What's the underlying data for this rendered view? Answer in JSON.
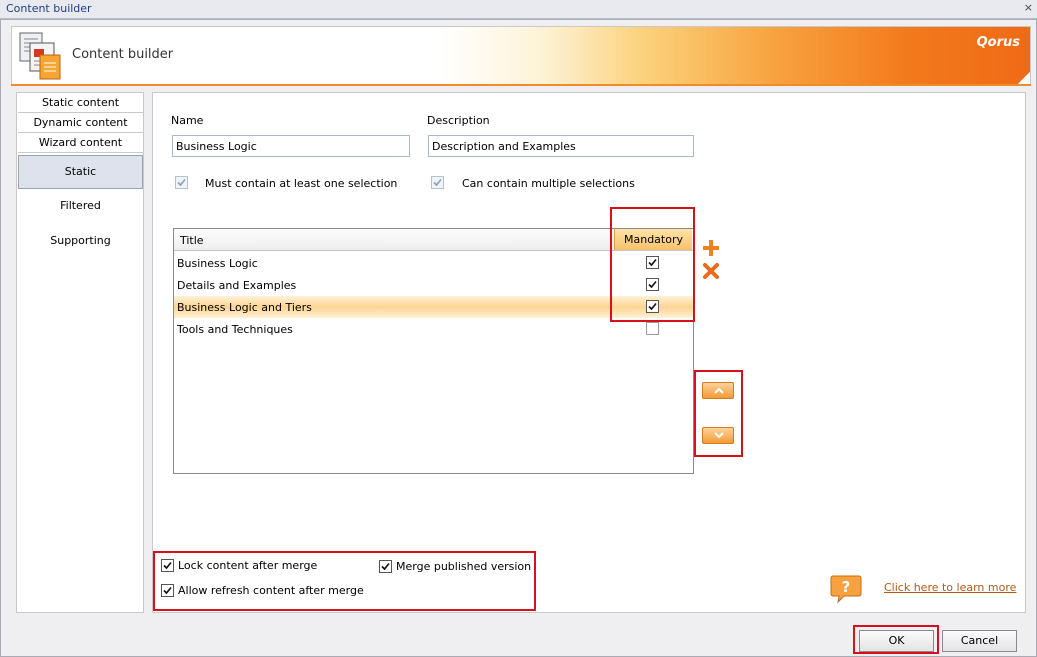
{
  "window": {
    "title": "Content builder",
    "close_glyph": "×"
  },
  "header": {
    "title": "Content builder",
    "brand": "Qorus",
    "icon": "documents-icon"
  },
  "sidebar": {
    "tabs": [
      {
        "label": "Static content"
      },
      {
        "label": "Dynamic content"
      },
      {
        "label": "Wizard content"
      }
    ],
    "items": [
      {
        "label": "Static",
        "active": true
      },
      {
        "label": "Filtered",
        "active": false
      },
      {
        "label": "Supporting",
        "active": false
      }
    ]
  },
  "form": {
    "name_label": "Name",
    "name_value": "Business Logic",
    "description_label": "Description",
    "description_value": "Description and Examples",
    "must_contain_label": "Must contain at least one selection",
    "must_contain_checked": true,
    "multiple_label": "Can contain multiple selections",
    "multiple_checked": true
  },
  "grid": {
    "columns": {
      "title": "Title",
      "mandatory": "Mandatory"
    },
    "rows": [
      {
        "title": "Business Logic",
        "mandatory": true,
        "selected": false
      },
      {
        "title": "Details and Examples",
        "mandatory": true,
        "selected": false
      },
      {
        "title": "Business Logic and Tiers",
        "mandatory": true,
        "selected": true
      },
      {
        "title": "Tools and Techniques",
        "mandatory": false,
        "selected": false
      }
    ]
  },
  "options": {
    "lock_label": "Lock content after merge",
    "lock_checked": true,
    "merge_label": "Merge published version",
    "merge_checked": true,
    "refresh_label": "Allow refresh content after merge",
    "refresh_checked": true
  },
  "help": {
    "link_text": "Click here to learn more",
    "icon": "question-bubble-icon"
  },
  "footer": {
    "ok_label": "OK",
    "cancel_label": "Cancel"
  },
  "colors": {
    "accent": "#f08b2a",
    "highlight": "#d7101c",
    "brand_text": "#ffffff"
  }
}
